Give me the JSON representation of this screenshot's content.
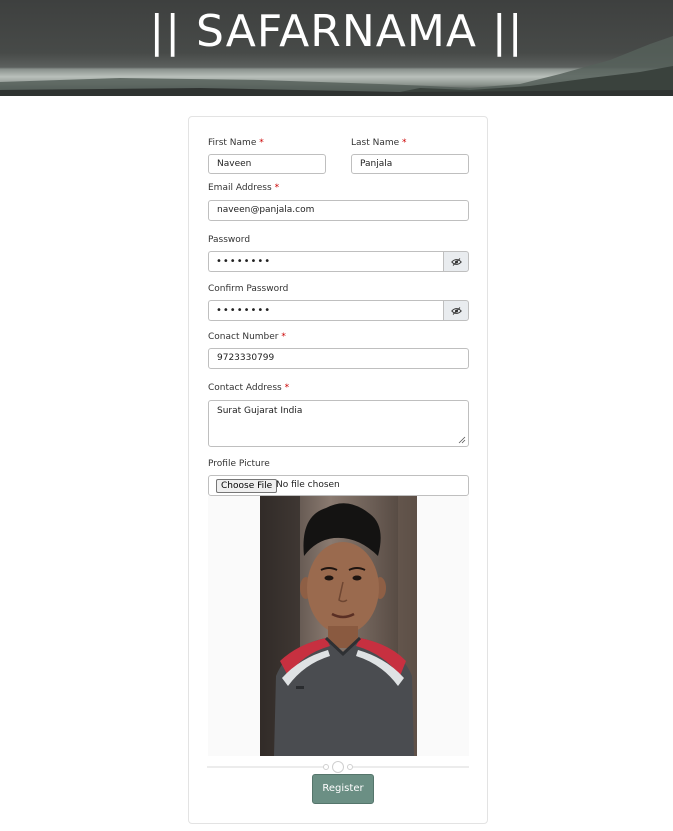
{
  "header": {
    "title": "|| SAFARNAMA ||"
  },
  "form": {
    "first_name": {
      "label": "First Name",
      "required": "*",
      "value": "Naveen"
    },
    "last_name": {
      "label": "Last Name",
      "required": "*",
      "value": "Panjala"
    },
    "email": {
      "label": "Email Address",
      "required": "*",
      "value": "naveen@panjala.com"
    },
    "password": {
      "label": "Password",
      "value": "••••••••",
      "toggle_icon": "eye-slash-icon"
    },
    "confirm_password": {
      "label": "Confirm Password",
      "value": "••••••••",
      "toggle_icon": "eye-slash-icon"
    },
    "contact_number": {
      "label": "Conact Number",
      "required": "*",
      "value": "9723330799"
    },
    "contact_address": {
      "label": "Contact Address",
      "required": "*",
      "value": "Surat Gujarat India"
    },
    "profile_picture": {
      "label": "Profile Picture",
      "button_label": "Choose File",
      "status": "No file chosen"
    },
    "register_label": "Register"
  },
  "colors": {
    "register_button": "#6b8f84",
    "required_marker": "#cc0000",
    "header_background": "#474a48"
  }
}
